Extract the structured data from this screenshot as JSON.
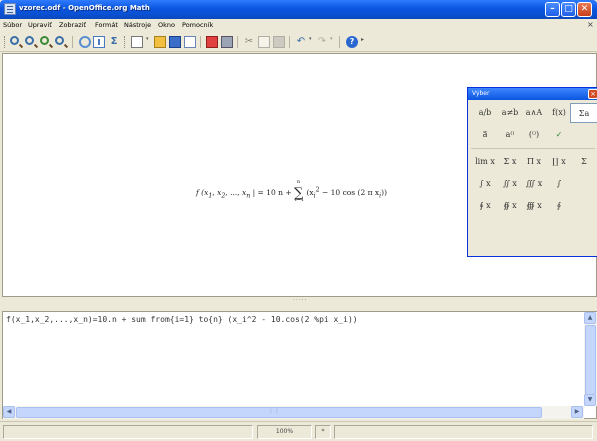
{
  "window": {
    "title": "vzorec.odf - OpenOffice.org Math"
  },
  "menubar": {
    "items": [
      "Súbor",
      "Upraviť",
      "Zobraziť",
      "Formát",
      "Nástroje",
      "Okno",
      "Pomocník"
    ]
  },
  "toolbar": {
    "icons": [
      "zoom-in",
      "zoom-out",
      "zoom-100",
      "zoom-all",
      "refresh",
      "formula-cursor",
      "symbols",
      "new",
      "open",
      "save",
      "email",
      "export-pdf",
      "print",
      "cut",
      "copy",
      "paste",
      "undo",
      "redo",
      "help"
    ]
  },
  "document": {
    "formula": {
      "lhs": "f (x",
      "rhs_prefix": "| = 10 n +",
      "sum_upper": "n",
      "sum_lower": "i=1",
      "body": "(x",
      "tail": "− 10 cos (2 π x",
      "end": "))"
    }
  },
  "selection_window": {
    "title": "Výber",
    "rows": [
      [
        "a/b",
        "a≠b",
        "a∧A",
        "f(x)",
        "Σa"
      ],
      [
        "a⃗",
        "a⁽⁾",
        "(⁽⁾)",
        "✓",
        ""
      ],
      [
        "lim x",
        "Σ x",
        "Π x",
        "∐ x",
        "Σ"
      ],
      [
        "∫ x",
        "∬ x",
        "∭ x",
        "∫",
        ""
      ],
      [
        "∮ x",
        "∯ x",
        "∰ x",
        "∮",
        ""
      ]
    ]
  },
  "command": {
    "text": "f(x_1,x_2,...,x_n)=10.n + sum from{i=1} to{n} (x_i^2 - 10.cos(2 %pi x_i))"
  },
  "statusbar": {
    "zoom": "100%",
    "mode": "*"
  },
  "colors": {
    "title_bar": "#0b56e0",
    "chrome": "#ece9d8",
    "scroll": "#c5d6fc"
  }
}
